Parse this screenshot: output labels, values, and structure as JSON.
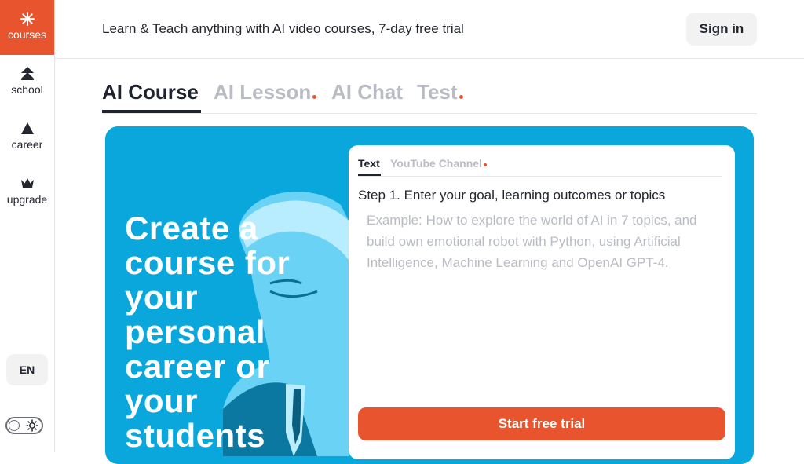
{
  "sidebar": {
    "items": [
      {
        "label": "courses",
        "icon": "sparkle-icon",
        "active": true
      },
      {
        "label": "school",
        "icon": "school-icon"
      },
      {
        "label": "career",
        "icon": "triangle-icon"
      },
      {
        "label": "upgrade",
        "icon": "crown-icon"
      }
    ],
    "language": "EN",
    "theme_icon": "sun-icon"
  },
  "header": {
    "tagline": "Learn & Teach anything with AI video courses, 7-day free trial",
    "signin_label": "Sign in"
  },
  "tabs": [
    {
      "label": "AI Course",
      "active": true
    },
    {
      "label": "AI Lesson",
      "dot": true
    },
    {
      "label": "AI Chat"
    },
    {
      "label": "Test",
      "dot": true
    }
  ],
  "hero": {
    "title": "Create a course for your personal career or your students"
  },
  "panel": {
    "tabs": [
      {
        "label": "Text",
        "active": true
      },
      {
        "label": "YouTube Channel",
        "dot": true
      }
    ],
    "step_label": "Step 1. Enter your goal, learning outcomes or topics",
    "input_value": "",
    "input_placeholder": "Example: How to explore the world of AI in 7 topics, and build own emotional robot with Python, using Artificial Intelligence, Machine Learning and OpenAI GPT-4.",
    "start_label": "Start free trial"
  },
  "colors": {
    "accent": "#e8542e",
    "hero_bg": "#0aa7dd",
    "text_dark": "#1f2330",
    "text_muted": "#b9bcc4"
  }
}
